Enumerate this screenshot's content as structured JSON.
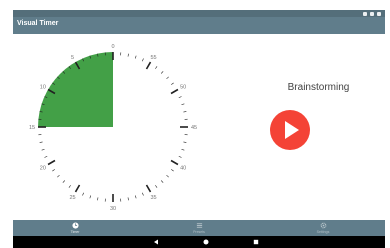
{
  "app": {
    "title": "Visual Timer"
  },
  "timer": {
    "label": "Brainstorming",
    "remaining_minutes": 15,
    "dial_max_minutes": 60,
    "fill_color": "#43a047",
    "play_color": "#f44336",
    "tick_labels": [
      "0",
      "5",
      "10",
      "15",
      "20",
      "25",
      "30",
      "35",
      "40",
      "45",
      "50",
      "55"
    ]
  },
  "bottom_nav": [
    {
      "label": "Timer",
      "icon": "clock-icon",
      "active": true
    },
    {
      "label": "Presets",
      "icon": "list-icon",
      "active": false
    },
    {
      "label": "Settings",
      "icon": "gear-icon",
      "active": false
    }
  ],
  "colors": {
    "toolbar": "#607d8b",
    "status": "#546e7a"
  }
}
